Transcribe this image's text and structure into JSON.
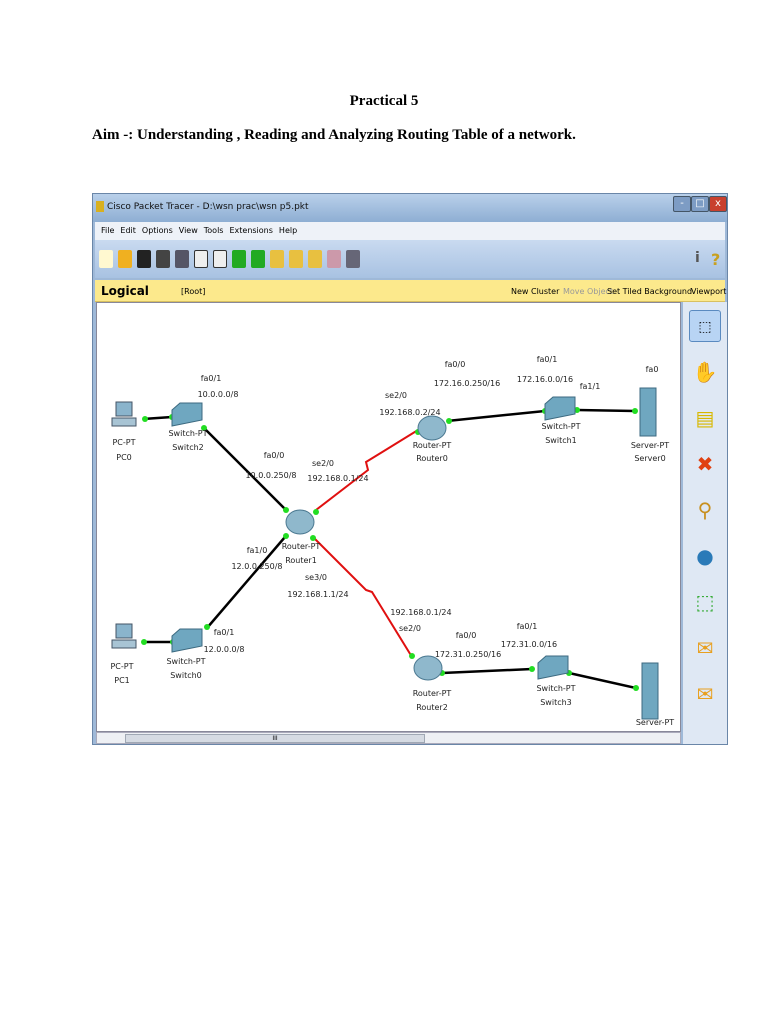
{
  "doc": {
    "title": "Practical 5",
    "aim": "Aim -: Understanding , Reading and Analyzing Routing Table of a network."
  },
  "window": {
    "title": "Cisco Packet Tracer - D:\\wsn prac\\wsn p5.pkt",
    "min": "-",
    "max": "□",
    "close": "x"
  },
  "menu": [
    "File",
    "Edit",
    "Options",
    "View",
    "Tools",
    "Extensions",
    "Help"
  ],
  "workspace": {
    "tab": "Logical",
    "root": "[Root]",
    "new_cluster": "New Cluster",
    "move_object": "Move Object",
    "set_bg": "Set Tiled Background",
    "viewport": "Viewport",
    "info": "i",
    "help": "?"
  },
  "scroll": {
    "grip": "III"
  },
  "devices": {
    "pc0": [
      "PC-PT",
      "PC0"
    ],
    "switch2": [
      "Switch-PT",
      "Switch2"
    ],
    "router1": [
      "Router-PT",
      "Router1"
    ],
    "router0": [
      "Router-PT",
      "Router0"
    ],
    "switch1": [
      "Switch-PT",
      "Switch1"
    ],
    "server0": [
      "Server-PT",
      "Server0"
    ],
    "pc1": [
      "PC-PT",
      "PC1"
    ],
    "switch0": [
      "Switch-PT",
      "Switch0"
    ],
    "router2": [
      "Router-PT",
      "Router2"
    ],
    "switch3": [
      "Switch-PT",
      "Switch3"
    ],
    "server1": [
      "Server-PT"
    ]
  },
  "labels": {
    "s2_fa01": "fa0/1",
    "s2_net": "10.0.0.0/8",
    "r1_fa00": "fa0/0",
    "r1_fa00_ip": "10.0.0.250/8",
    "r1_se20": "se2/0",
    "r1_se20_ip": "192.168.0.1/24",
    "r1_fa10": "fa1/0",
    "r1_fa10_ip": "12.0.0.250/8",
    "r1_se30": "se3/0",
    "r1_se30_ip": "192.168.1.1/24",
    "s0_fa01": "fa0/1",
    "s0_net": "12.0.0.0/8",
    "r0_se20": "se2/0",
    "r0_se20_ip": "192.168.0.2/24",
    "r0_fa00": "fa0/0",
    "r0_fa00_ip": "172.16.0.250/16",
    "s1_fa01": "fa0/1",
    "s1_net": "172.16.0.0/16",
    "s1_fa11": "fa1/1",
    "sv0_fa0": "fa0",
    "r2_ip": "192.168.0.1/24",
    "r2_se20": "se2/0",
    "r2_fa00": "fa0/0",
    "r2_fa00_ip": "172.31.0.250/16",
    "s3_fa01": "fa0/1",
    "s3_net": "172.31.0.0/16"
  },
  "colors": {
    "serial": "#e01010",
    "ethernet": "#000000",
    "link_up": "#22dd22"
  }
}
